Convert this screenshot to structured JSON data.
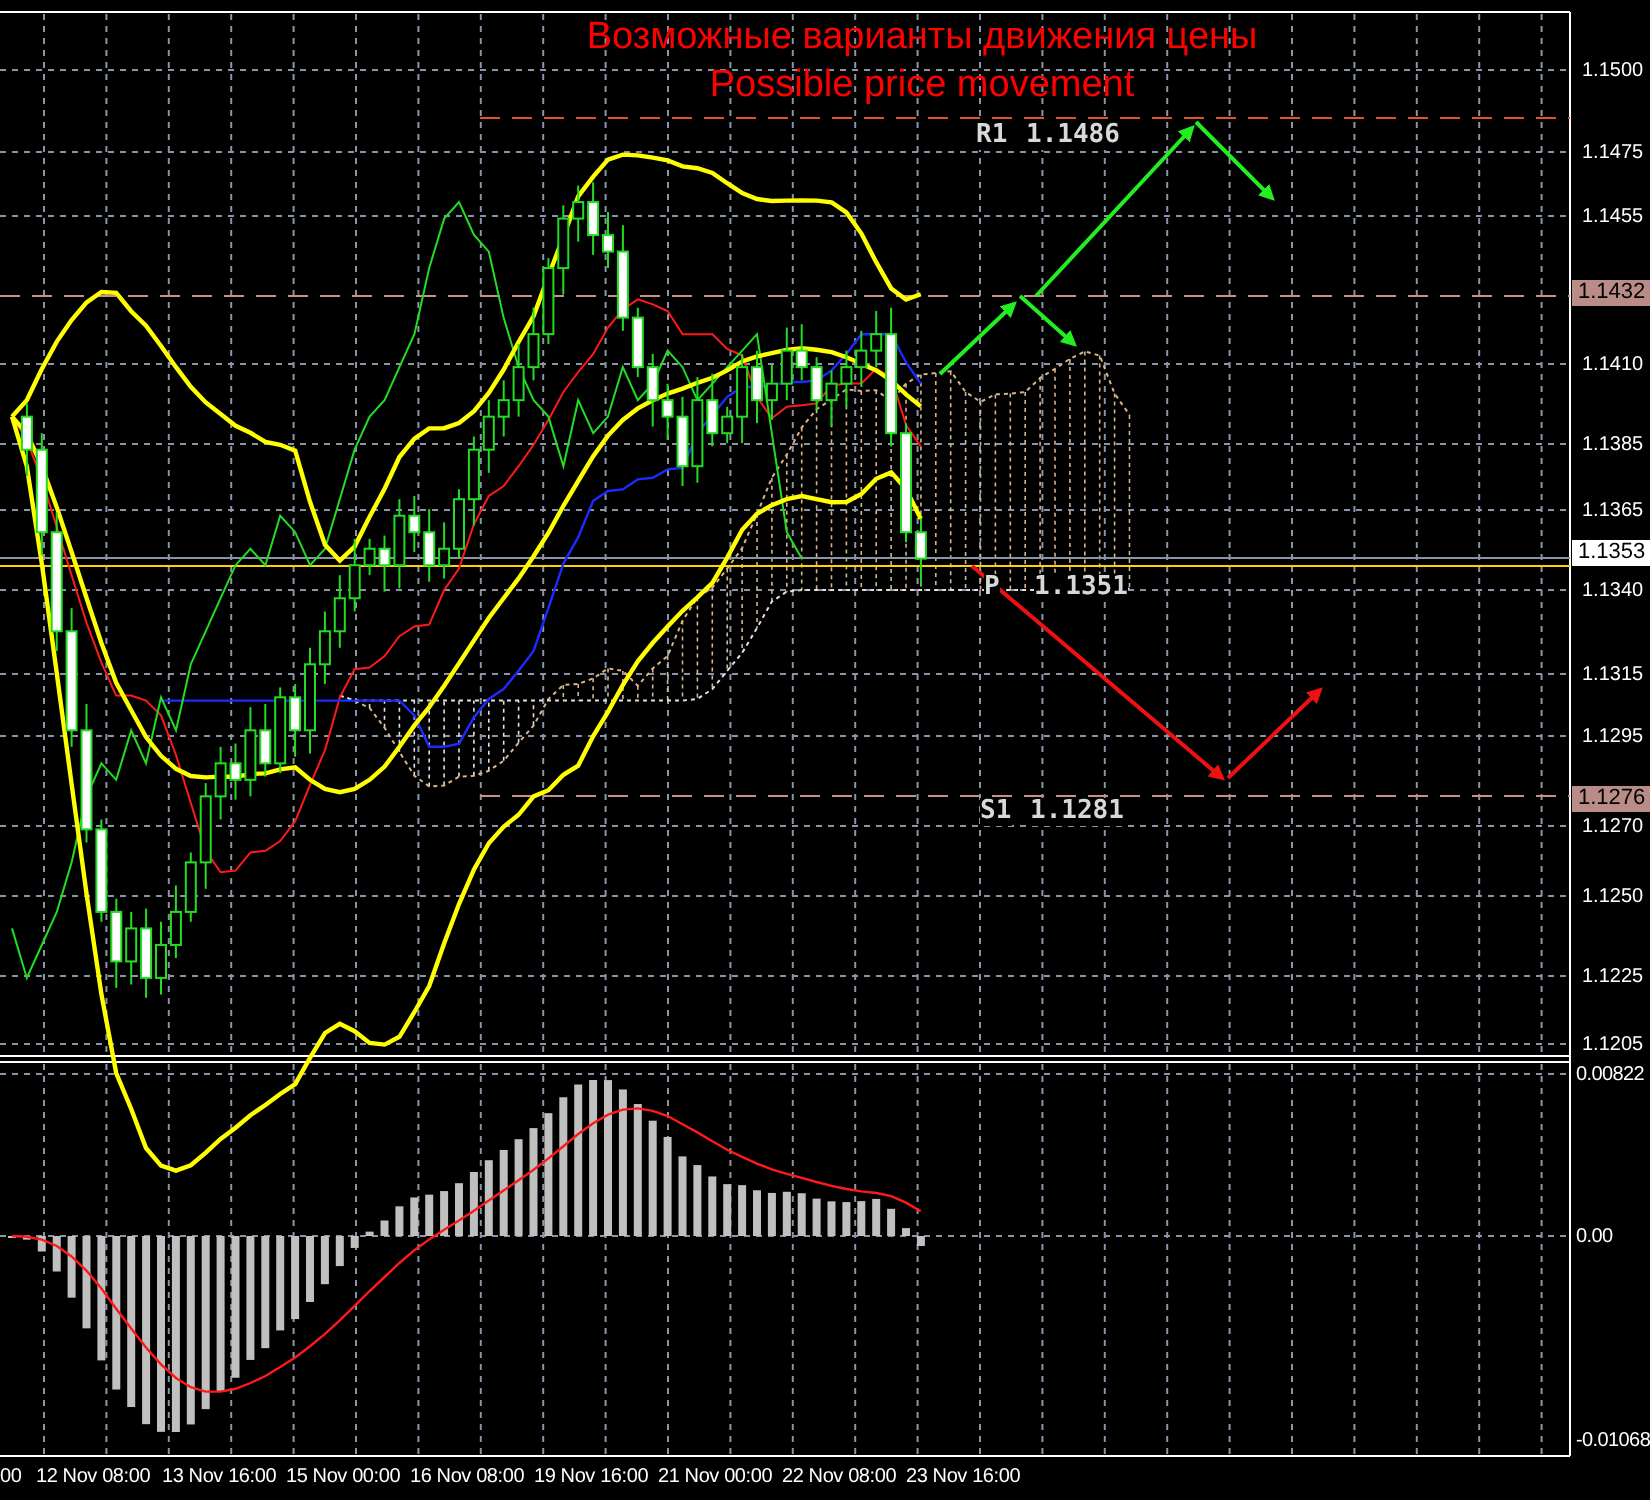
{
  "title": {
    "lines": [
      "Возможные варианты движения цены",
      "Possible price movement"
    ]
  },
  "price_axis": {
    "ticks": [
      "1.1500",
      "1.1475",
      "1.1455",
      "1.1410",
      "1.1385",
      "1.1365",
      "1.1340",
      "1.1315",
      "1.1295",
      "1.1270",
      "1.1250",
      "1.1225",
      "1.1205"
    ],
    "markers": [
      {
        "label": "1.1432",
        "kind": "level"
      },
      {
        "label": "1.1353",
        "kind": "current"
      },
      {
        "label": "1.1276",
        "kind": "level"
      }
    ]
  },
  "levels": [
    {
      "name": "R1",
      "value": "1.1486"
    },
    {
      "name": "P",
      "value": "1.1351"
    },
    {
      "name": "S1",
      "value": "1.1281"
    }
  ],
  "oscillator_axis": {
    "ticks": [
      "0.00822",
      "0.00",
      "-0.01068"
    ]
  },
  "time_axis": {
    "ticks": [
      "00",
      "12 Nov 08:00",
      "13 Nov 16:00",
      "15 Nov 00:00",
      "16 Nov 08:00",
      "19 Nov 16:00",
      "21 Nov 00:00",
      "22 Nov 08:00",
      "23 Nov 16:00"
    ]
  }
}
